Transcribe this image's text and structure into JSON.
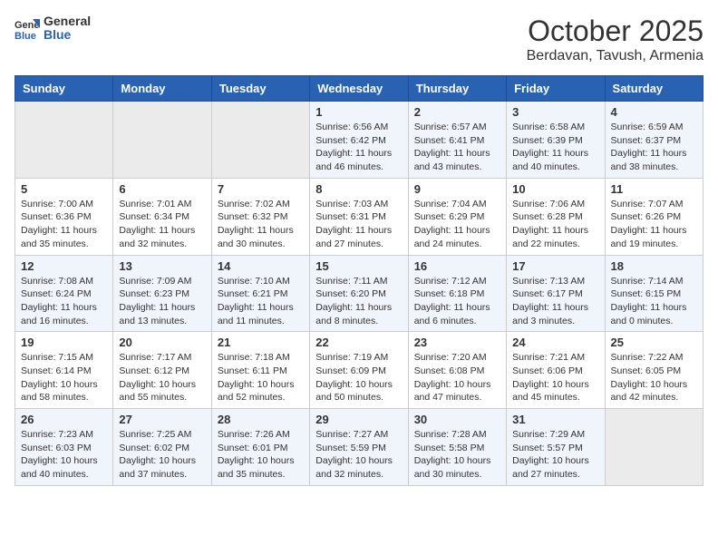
{
  "logo": {
    "line1": "General",
    "line2": "Blue"
  },
  "title": "October 2025",
  "location": "Berdavan, Tavush, Armenia",
  "days_of_week": [
    "Sunday",
    "Monday",
    "Tuesday",
    "Wednesday",
    "Thursday",
    "Friday",
    "Saturday"
  ],
  "weeks": [
    [
      {
        "day": "",
        "info": ""
      },
      {
        "day": "",
        "info": ""
      },
      {
        "day": "",
        "info": ""
      },
      {
        "day": "1",
        "info": "Sunrise: 6:56 AM\nSunset: 6:42 PM\nDaylight: 11 hours\nand 46 minutes."
      },
      {
        "day": "2",
        "info": "Sunrise: 6:57 AM\nSunset: 6:41 PM\nDaylight: 11 hours\nand 43 minutes."
      },
      {
        "day": "3",
        "info": "Sunrise: 6:58 AM\nSunset: 6:39 PM\nDaylight: 11 hours\nand 40 minutes."
      },
      {
        "day": "4",
        "info": "Sunrise: 6:59 AM\nSunset: 6:37 PM\nDaylight: 11 hours\nand 38 minutes."
      }
    ],
    [
      {
        "day": "5",
        "info": "Sunrise: 7:00 AM\nSunset: 6:36 PM\nDaylight: 11 hours\nand 35 minutes."
      },
      {
        "day": "6",
        "info": "Sunrise: 7:01 AM\nSunset: 6:34 PM\nDaylight: 11 hours\nand 32 minutes."
      },
      {
        "day": "7",
        "info": "Sunrise: 7:02 AM\nSunset: 6:32 PM\nDaylight: 11 hours\nand 30 minutes."
      },
      {
        "day": "8",
        "info": "Sunrise: 7:03 AM\nSunset: 6:31 PM\nDaylight: 11 hours\nand 27 minutes."
      },
      {
        "day": "9",
        "info": "Sunrise: 7:04 AM\nSunset: 6:29 PM\nDaylight: 11 hours\nand 24 minutes."
      },
      {
        "day": "10",
        "info": "Sunrise: 7:06 AM\nSunset: 6:28 PM\nDaylight: 11 hours\nand 22 minutes."
      },
      {
        "day": "11",
        "info": "Sunrise: 7:07 AM\nSunset: 6:26 PM\nDaylight: 11 hours\nand 19 minutes."
      }
    ],
    [
      {
        "day": "12",
        "info": "Sunrise: 7:08 AM\nSunset: 6:24 PM\nDaylight: 11 hours\nand 16 minutes."
      },
      {
        "day": "13",
        "info": "Sunrise: 7:09 AM\nSunset: 6:23 PM\nDaylight: 11 hours\nand 13 minutes."
      },
      {
        "day": "14",
        "info": "Sunrise: 7:10 AM\nSunset: 6:21 PM\nDaylight: 11 hours\nand 11 minutes."
      },
      {
        "day": "15",
        "info": "Sunrise: 7:11 AM\nSunset: 6:20 PM\nDaylight: 11 hours\nand 8 minutes."
      },
      {
        "day": "16",
        "info": "Sunrise: 7:12 AM\nSunset: 6:18 PM\nDaylight: 11 hours\nand 6 minutes."
      },
      {
        "day": "17",
        "info": "Sunrise: 7:13 AM\nSunset: 6:17 PM\nDaylight: 11 hours\nand 3 minutes."
      },
      {
        "day": "18",
        "info": "Sunrise: 7:14 AM\nSunset: 6:15 PM\nDaylight: 11 hours\nand 0 minutes."
      }
    ],
    [
      {
        "day": "19",
        "info": "Sunrise: 7:15 AM\nSunset: 6:14 PM\nDaylight: 10 hours\nand 58 minutes."
      },
      {
        "day": "20",
        "info": "Sunrise: 7:17 AM\nSunset: 6:12 PM\nDaylight: 10 hours\nand 55 minutes."
      },
      {
        "day": "21",
        "info": "Sunrise: 7:18 AM\nSunset: 6:11 PM\nDaylight: 10 hours\nand 52 minutes."
      },
      {
        "day": "22",
        "info": "Sunrise: 7:19 AM\nSunset: 6:09 PM\nDaylight: 10 hours\nand 50 minutes."
      },
      {
        "day": "23",
        "info": "Sunrise: 7:20 AM\nSunset: 6:08 PM\nDaylight: 10 hours\nand 47 minutes."
      },
      {
        "day": "24",
        "info": "Sunrise: 7:21 AM\nSunset: 6:06 PM\nDaylight: 10 hours\nand 45 minutes."
      },
      {
        "day": "25",
        "info": "Sunrise: 7:22 AM\nSunset: 6:05 PM\nDaylight: 10 hours\nand 42 minutes."
      }
    ],
    [
      {
        "day": "26",
        "info": "Sunrise: 7:23 AM\nSunset: 6:03 PM\nDaylight: 10 hours\nand 40 minutes."
      },
      {
        "day": "27",
        "info": "Sunrise: 7:25 AM\nSunset: 6:02 PM\nDaylight: 10 hours\nand 37 minutes."
      },
      {
        "day": "28",
        "info": "Sunrise: 7:26 AM\nSunset: 6:01 PM\nDaylight: 10 hours\nand 35 minutes."
      },
      {
        "day": "29",
        "info": "Sunrise: 7:27 AM\nSunset: 5:59 PM\nDaylight: 10 hours\nand 32 minutes."
      },
      {
        "day": "30",
        "info": "Sunrise: 7:28 AM\nSunset: 5:58 PM\nDaylight: 10 hours\nand 30 minutes."
      },
      {
        "day": "31",
        "info": "Sunrise: 7:29 AM\nSunset: 5:57 PM\nDaylight: 10 hours\nand 27 minutes."
      },
      {
        "day": "",
        "info": ""
      }
    ]
  ]
}
